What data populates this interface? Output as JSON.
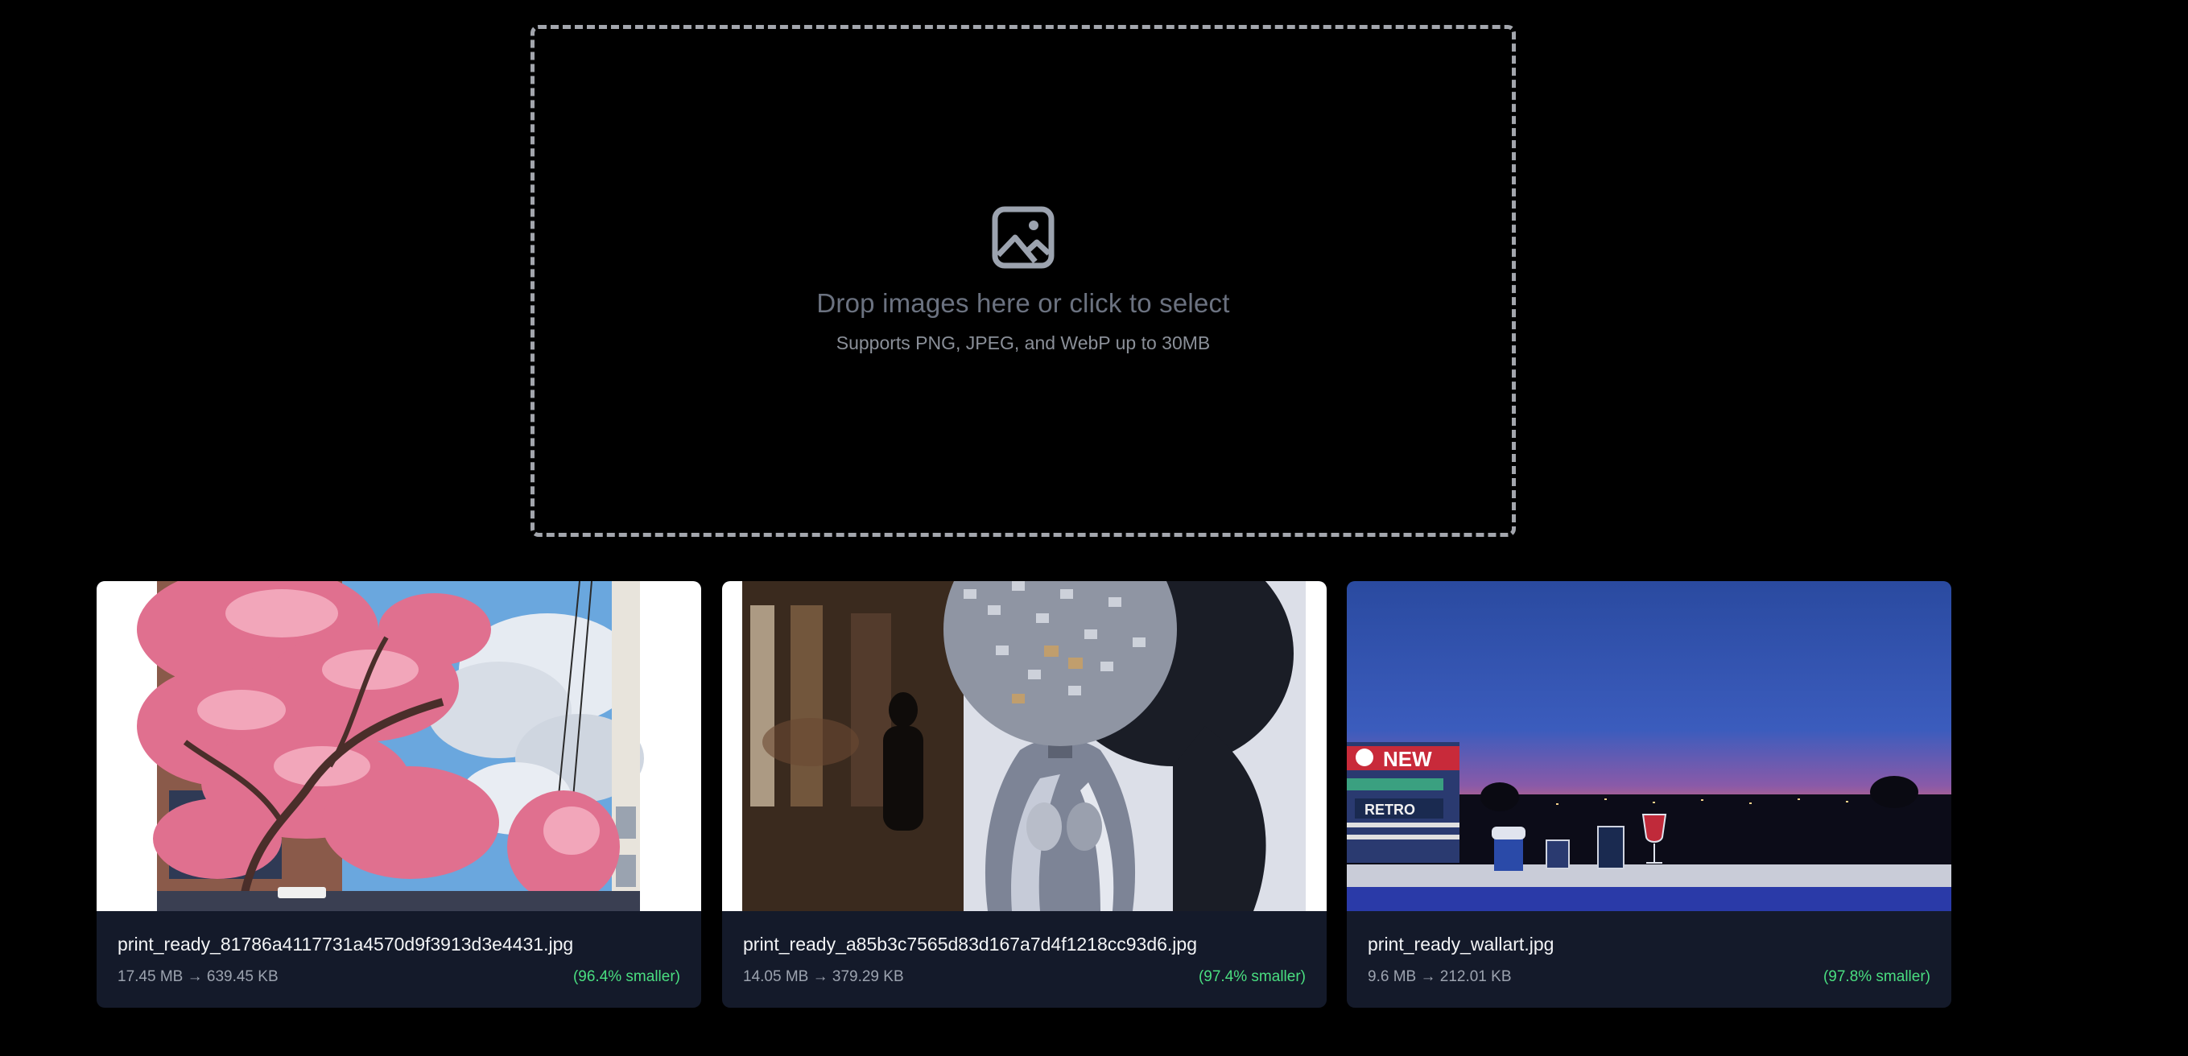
{
  "dropzone": {
    "icon": "image-icon",
    "title": "Drop images here or click to select",
    "subtitle": "Supports PNG, JPEG, and WebP up to 30MB"
  },
  "colors": {
    "background": "#000000",
    "card_bg": "#141a2a",
    "savings_green": "#4ade80",
    "dropzone_border": "#a3a6ad"
  },
  "images": [
    {
      "filename": "print_ready_81786a4117731a4570d9f3913d3e4431.jpg",
      "size_text": "17.45 MB → 639.45 KB",
      "savings_text": "(96.4% smaller)",
      "thumbnail": "cherry-blossom-street-illustration"
    },
    {
      "filename": "print_ready_a85b3c7565d83d167a7d4f1218cc93d6.jpg",
      "size_text": "14.05 MB → 379.29 KB",
      "savings_text": "(97.4% smaller)",
      "thumbnail": "disco-ball-head-chrome-figure-photo"
    },
    {
      "filename": "print_ready_wallart.jpg",
      "size_text": "9.6 MB → 212.01 KB",
      "savings_text": "(97.8% smaller)",
      "thumbnail": "retro-sunset-bar-illustration",
      "thumb_texts": [
        "NEW",
        "RETRO"
      ]
    }
  ]
}
